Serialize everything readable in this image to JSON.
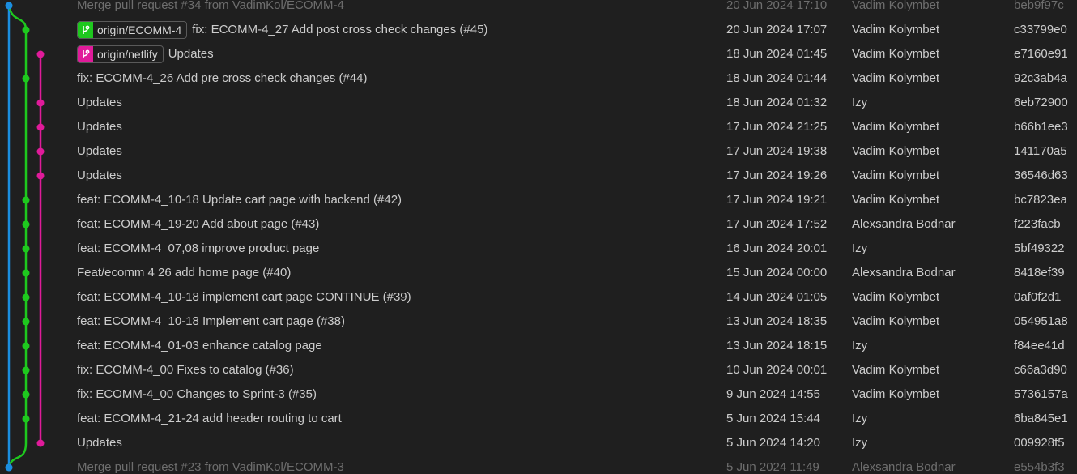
{
  "colors": {
    "background": "#1f1f1f",
    "text": "#cccccc",
    "dim_text": "#6e6e6e",
    "lane_main": "#1b8ee0",
    "lane_ecomm4": "#1ec81e",
    "lane_netlify": "#e01b9a"
  },
  "commits": [
    {
      "message": "Merge pull request #34 from VadimKol/ECOMM-4",
      "date": "20 Jun 2024 17:10",
      "author": "Vadim Kolymbet",
      "sha": "beb9f97c",
      "dim": true,
      "lane": "main"
    },
    {
      "message": "fix: ECOMM-4_27 Add post cross check changes (#45)",
      "date": "20 Jun 2024 17:07",
      "author": "Vadim Kolymbet",
      "sha": "c33799e0",
      "lane": "ecomm4",
      "branch": {
        "label": "origin/ECOMM-4",
        "icon": "branch-icon",
        "color": "#1ec81e"
      }
    },
    {
      "message": "Updates",
      "date": "18 Jun 2024 01:45",
      "author": "Vadim Kolymbet",
      "sha": "e7160e91",
      "lane": "netlify",
      "branch": {
        "label": "origin/netlify",
        "icon": "branch-icon",
        "color": "#e01b9a"
      }
    },
    {
      "message": "fix: ECOMM-4_26 Add pre cross check changes (#44)",
      "date": "18 Jun 2024 01:44",
      "author": "Vadim Kolymbet",
      "sha": "92c3ab4a",
      "lane": "ecomm4"
    },
    {
      "message": "Updates",
      "date": "18 Jun 2024 01:32",
      "author": "Izy",
      "sha": "6eb72900",
      "lane": "netlify"
    },
    {
      "message": "Updates",
      "date": "17 Jun 2024 21:25",
      "author": "Vadim Kolymbet",
      "sha": "b66b1ee3",
      "lane": "netlify"
    },
    {
      "message": "Updates",
      "date": "17 Jun 2024 19:38",
      "author": "Vadim Kolymbet",
      "sha": "141170a5",
      "lane": "netlify"
    },
    {
      "message": "Updates",
      "date": "17 Jun 2024 19:26",
      "author": "Vadim Kolymbet",
      "sha": "36546d63",
      "lane": "netlify"
    },
    {
      "message": "feat: ECOMM-4_10-18 Update cart page with backend (#42)",
      "date": "17 Jun 2024 19:21",
      "author": "Vadim Kolymbet",
      "sha": "bc7823ea",
      "lane": "ecomm4"
    },
    {
      "message": "feat: ECOMM-4_19-20 Add about page (#43)",
      "date": "17 Jun 2024 17:52",
      "author": "Alexsandra Bodnar",
      "sha": "f223facb",
      "lane": "ecomm4"
    },
    {
      "message": "feat: ECOMM-4_07,08 improve product page",
      "date": "16 Jun 2024 20:01",
      "author": "Izy",
      "sha": "5bf49322",
      "lane": "ecomm4"
    },
    {
      "message": "Feat/ecomm 4 26 add home page (#40)",
      "date": "15 Jun 2024 00:00",
      "author": "Alexsandra Bodnar",
      "sha": "8418ef39",
      "lane": "ecomm4"
    },
    {
      "message": "feat: ECOMM-4_10-18 implement cart page CONTINUE (#39)",
      "date": "14 Jun 2024 01:05",
      "author": "Vadim Kolymbet",
      "sha": "0af0f2d1",
      "lane": "ecomm4"
    },
    {
      "message": "feat: ECOMM-4_10-18 Implement cart page (#38)",
      "date": "13 Jun 2024 18:35",
      "author": "Vadim Kolymbet",
      "sha": "054951a8",
      "lane": "ecomm4"
    },
    {
      "message": "feat: ECOMM-4_01-03 enhance catalog page",
      "date": "13 Jun 2024 18:15",
      "author": "Izy",
      "sha": "f84ee41d",
      "lane": "ecomm4"
    },
    {
      "message": "fix: ECOMM-4_00 Fixes to catalog (#36)",
      "date": "10 Jun 2024 00:01",
      "author": "Vadim Kolymbet",
      "sha": "c66a3d90",
      "lane": "ecomm4"
    },
    {
      "message": "fix: ECOMM-4_00 Changes to Sprint-3 (#35)",
      "date": "9 Jun 2024 14:55",
      "author": "Vadim Kolymbet",
      "sha": "5736157a",
      "lane": "ecomm4"
    },
    {
      "message": "feat: ECOMM-4_21-24 add header routing to cart",
      "date": "5 Jun 2024 15:44",
      "author": "Izy",
      "sha": "6ba845e1",
      "lane": "ecomm4"
    },
    {
      "message": "Updates",
      "date": "5 Jun 2024 14:20",
      "author": "Izy",
      "sha": "009928f5",
      "lane": "netlify"
    },
    {
      "message": "Merge pull request #23 from VadimKol/ECOMM-3",
      "date": "5 Jun 2024 11:49",
      "author": "Alexsandra Bodnar",
      "sha": "e554b3f3",
      "dim": true,
      "lane": "main"
    }
  ]
}
